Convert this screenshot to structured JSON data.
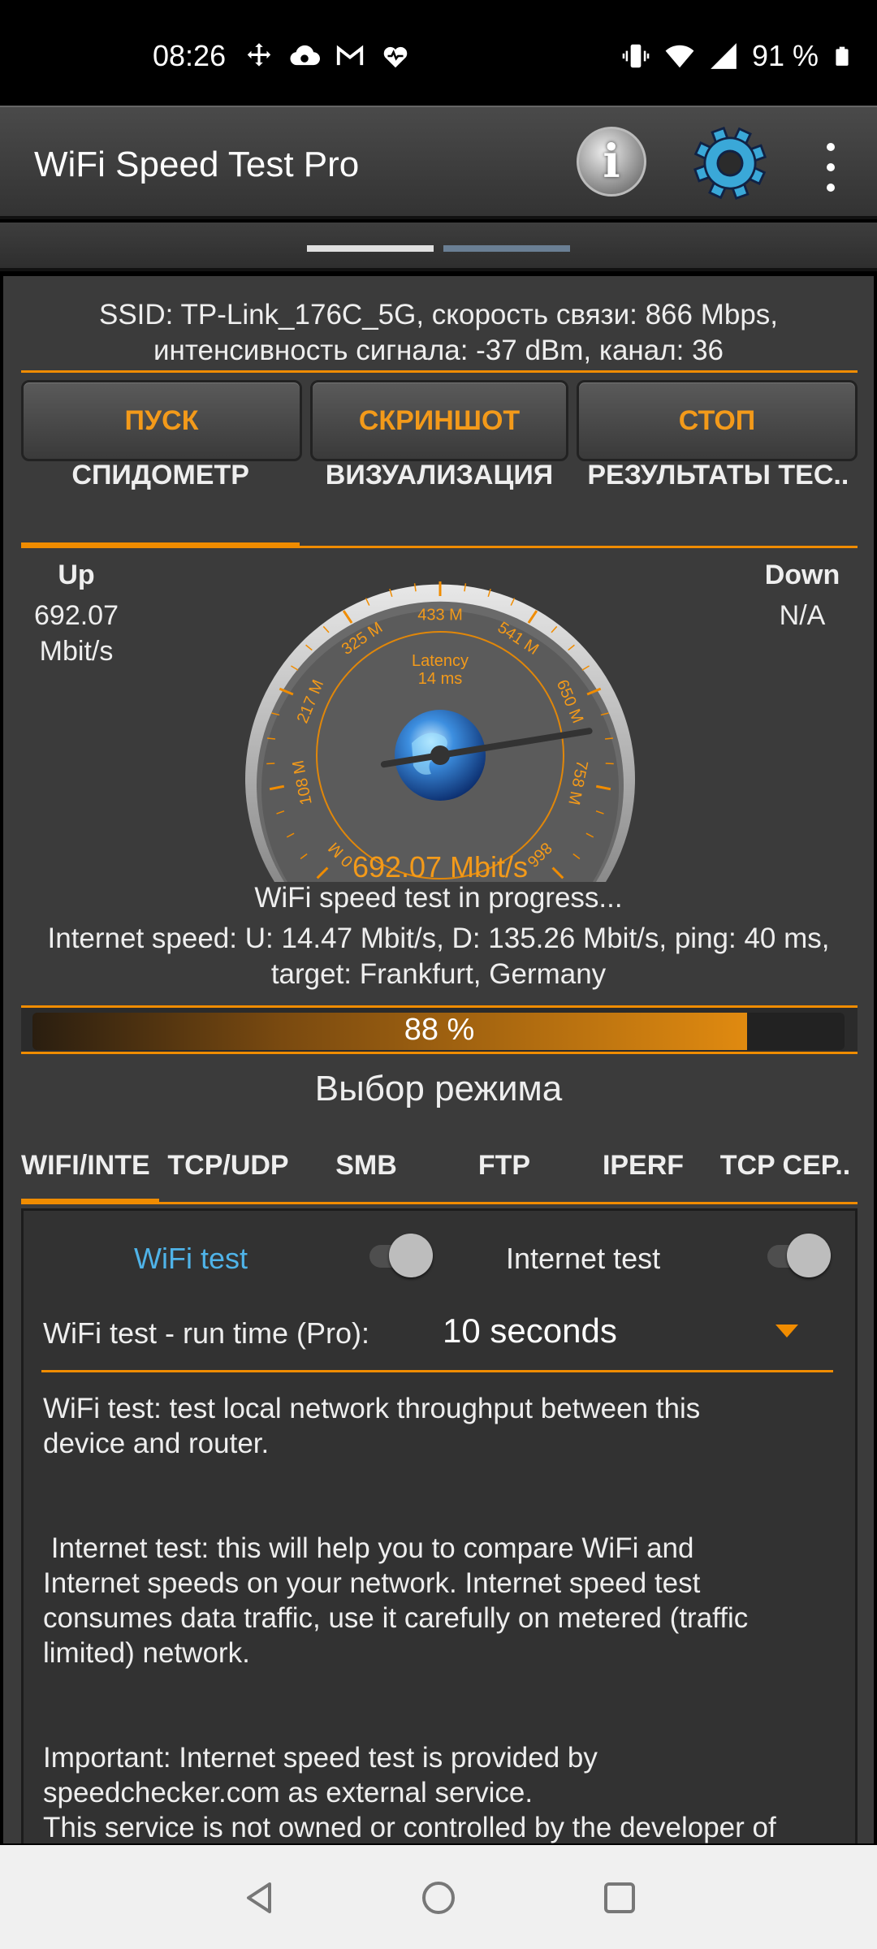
{
  "status_bar": {
    "time": "08:26",
    "battery": "91 %",
    "left_icons": [
      "move-icon",
      "cloud-sync-icon",
      "gmail-icon",
      "heart-icon"
    ],
    "right_icons": [
      "vibrate-icon",
      "wifi-icon",
      "signal-icon",
      "battery-icon"
    ]
  },
  "app_bar": {
    "title": "WiFi Speed Test Pro"
  },
  "connection": {
    "line1": "SSID: TP-Link_176C_5G, скорость связи: 866 Mbps,",
    "line2": "интенсивность сигнала: -37 dBm, канал: 36"
  },
  "controls": {
    "start": "ПУСК",
    "screenshot": "СКРИНШОТ",
    "stop": "СТОП"
  },
  "view_tabs": [
    {
      "label": "СПИДОМЕТР",
      "active": true
    },
    {
      "label": "ВИЗУАЛИЗАЦИЯ",
      "active": false
    },
    {
      "label": "РЕЗУЛЬТАТЫ ТЕС..",
      "active": false
    }
  ],
  "speed": {
    "up_label": "Up",
    "up_value": "692.07",
    "up_unit": "Mbit/s",
    "down_label": "Down",
    "down_value": "N/A"
  },
  "gauge": {
    "latency_label": "Latency",
    "latency_value": "14 ms",
    "readout": "692.07 Mbit/s",
    "current_mbit": 692.07,
    "max_mbit": 866,
    "ticks": [
      "0 M",
      "108 M",
      "217 M",
      "325 M",
      "433 M",
      "541 M",
      "650 M",
      "758 M",
      "866"
    ]
  },
  "test_status": "WiFi speed test in progress...",
  "internet_line1": "Internet speed: U: 14.47 Mbit/s, D: 135.26 Mbit/s, ping: 40 ms,",
  "internet_line2": "target: Frankfurt, Germany",
  "progress": {
    "label": "88 %",
    "fraction": 0.88
  },
  "mode_title": "Выбор режима",
  "mode_tabs": [
    {
      "label": "WIFI/INTE",
      "active": true
    },
    {
      "label": "TCP/UDP",
      "active": false
    },
    {
      "label": "SMB",
      "active": false
    },
    {
      "label": "FTP",
      "active": false
    },
    {
      "label": "IPERF",
      "active": false
    },
    {
      "label": "TCP СЕР..",
      "active": false
    }
  ],
  "panel": {
    "wifi_test_label": "WiFi test",
    "internet_test_label": "Internet test",
    "runtime_label": "WiFi test - run time (Pro):",
    "runtime_value": "10 seconds",
    "desc1": "WiFi test: test local network throughput between this\ndevice and router.",
    "desc2": " Internet test: this will help you to compare WiFi and\nInternet speeds on your network. Internet speed test\nconsumes data traffic, use it carefully on metered (traffic\nlimited) network.",
    "desc3": "Important: Internet speed test is provided by\nspeedchecker.com as external service.\nThis service is not owned or controlled by the developer of\nthis app."
  },
  "colors": {
    "accent": "#f08c00",
    "link_blue": "#4fb3e8"
  }
}
